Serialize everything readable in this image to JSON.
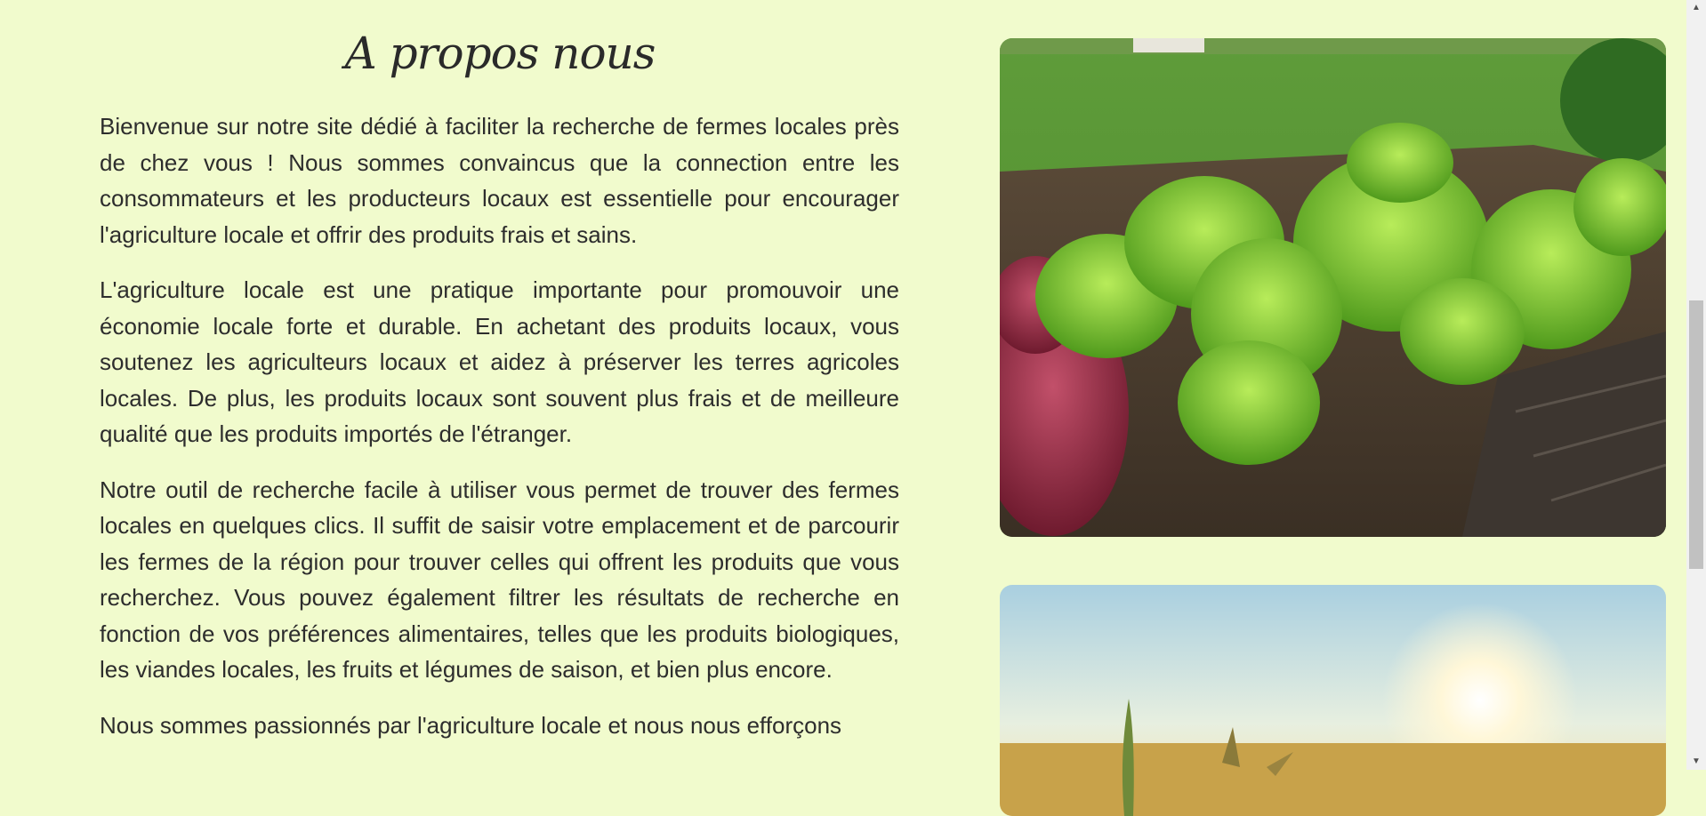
{
  "about": {
    "title": "A propos nous",
    "paragraphs": [
      "Bienvenue sur notre site dédié à faciliter la recherche de fermes locales près de chez vous ! Nous sommes convaincus que la connection entre les consommateurs et les producteurs locaux est essentielle pour encourager l'agriculture locale et offrir des produits frais et sains.",
      "L'agriculture locale est une pratique importante pour promouvoir une économie locale forte et durable. En achetant des produits locaux, vous soutenez les agriculteurs locaux et aidez à préserver les terres agricoles locales. De plus, les produits locaux sont souvent plus frais et de meilleure qualité que les produits importés de l'étranger.",
      "Notre outil de recherche facile à utiliser vous permet de trouver des fermes locales en quelques clics. Il suffit de saisir votre emplacement et de parcourir les fermes de la région pour trouver celles qui offrent les produits que vous recherchez. Vous pouvez également filtrer les résultats de recherche en fonction de vos préférences alimentaires, telles que les produits biologiques, les viandes locales, les fruits et légumes de saison, et bien plus encore.",
      "Nous sommes passionnés par l'agriculture locale et nous nous efforçons"
    ]
  },
  "colors": {
    "page_background": "#f1fbcd",
    "text": "#2d2d2d"
  },
  "scrollbar": {
    "up_glyph": "▲",
    "down_glyph": "▼"
  }
}
